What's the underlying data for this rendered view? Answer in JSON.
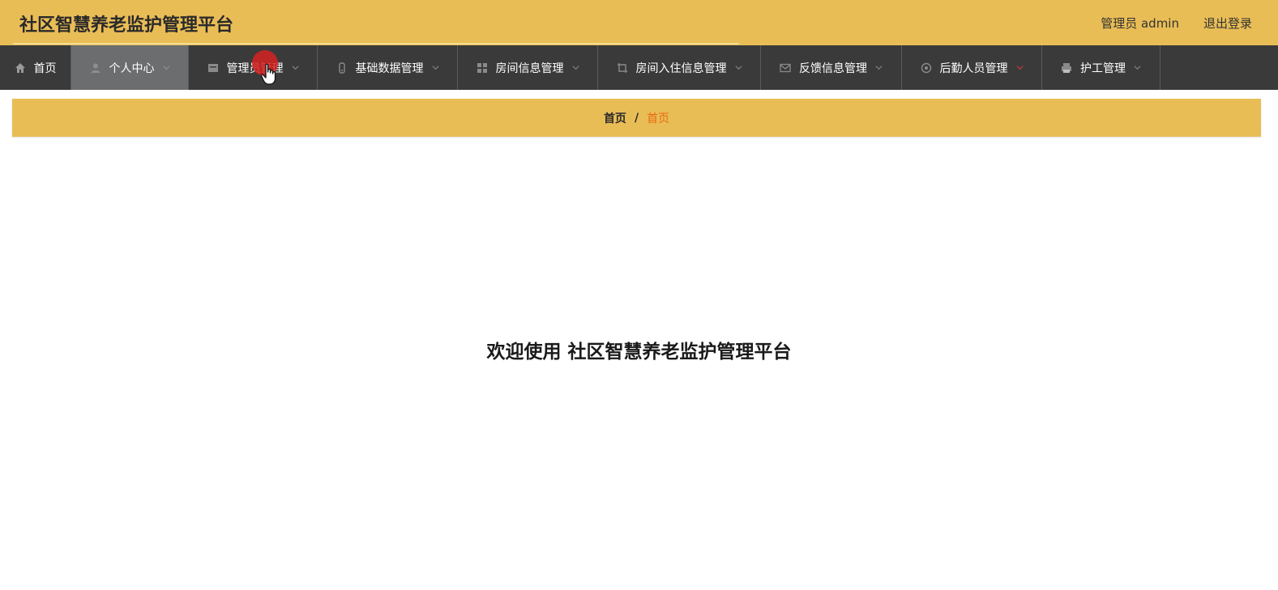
{
  "header": {
    "app_title": "社区智慧养老监护管理平台",
    "user_info": "管理员 admin",
    "logout_label": "退出登录"
  },
  "nav": {
    "items": [
      {
        "label": "首页",
        "icon": "home-icon"
      },
      {
        "label": "个人中心",
        "icon": "user-icon",
        "active": true
      },
      {
        "label": "管理员管理",
        "icon": "card-icon"
      },
      {
        "label": "基础数据管理",
        "icon": "database-icon"
      },
      {
        "label": "房间信息管理",
        "icon": "grid-icon"
      },
      {
        "label": "房间入住信息管理",
        "icon": "crop-icon"
      },
      {
        "label": "反馈信息管理",
        "icon": "mail-icon"
      },
      {
        "label": "后勤人员管理",
        "icon": "aperture-icon"
      },
      {
        "label": "护工管理",
        "icon": "printer-icon"
      }
    ]
  },
  "breadcrumb": {
    "home": "首页",
    "separator": "/",
    "current": "首页"
  },
  "main": {
    "welcome_text": "欢迎使用 社区智慧养老监护管理平台"
  },
  "colors": {
    "header_bg": "#e9bd56",
    "nav_bg": "#3a3a3a",
    "nav_active_bg": "#6b6d6f",
    "breadcrumb_current": "#e56b10"
  }
}
